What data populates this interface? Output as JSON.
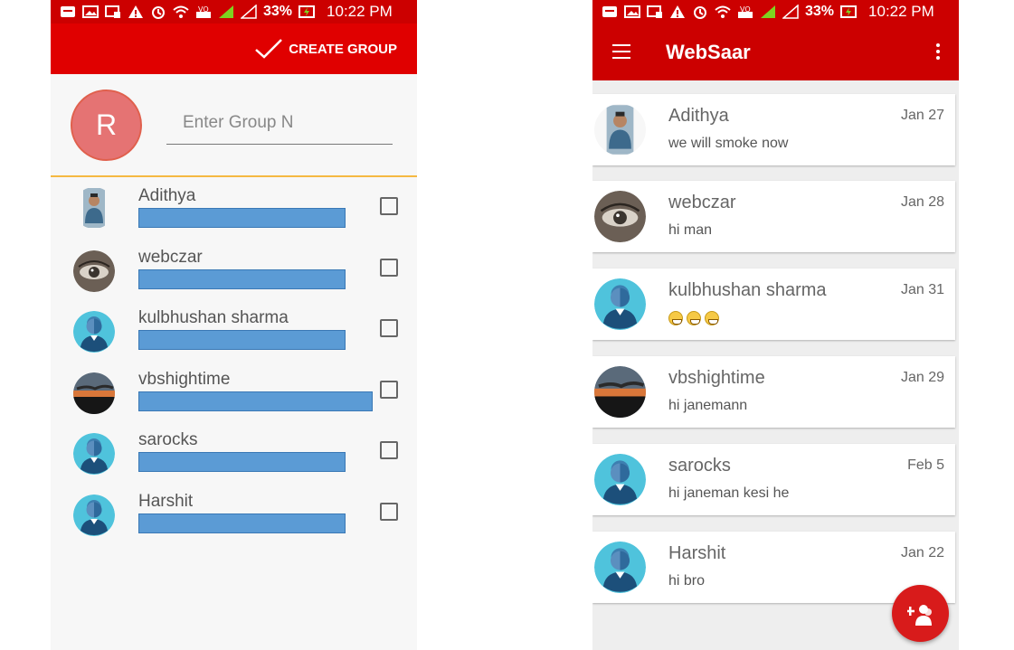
{
  "status_bar": {
    "battery": "33%",
    "time": "10:22 PM"
  },
  "left": {
    "create_group_label": "CREATE GROUP",
    "group_avatar_letter": "R",
    "group_name_value": "Enter Group N",
    "members": [
      {
        "name": "Adithya",
        "avatar": "photo-person"
      },
      {
        "name": "webczar",
        "avatar": "photo-eye"
      },
      {
        "name": "kulbhushan sharma",
        "avatar": "default-user"
      },
      {
        "name": "vbshightime",
        "avatar": "photo-sunset"
      },
      {
        "name": "sarocks",
        "avatar": "default-user"
      },
      {
        "name": "Harshit",
        "avatar": "default-user"
      }
    ]
  },
  "right": {
    "app_title": "WebSaar",
    "chats": [
      {
        "name": "Adithya",
        "date": "Jan 27",
        "message": "we will smoke now",
        "avatar": "photo-person"
      },
      {
        "name": "webczar",
        "date": "Jan 28",
        "message": "hi man",
        "avatar": "photo-eye"
      },
      {
        "name": "kulbhushan sharma",
        "date": "Jan 31",
        "message": "",
        "emoji_count": 3,
        "avatar": "default-user"
      },
      {
        "name": "vbshightime",
        "date": "Jan 29",
        "message": "hi janemann",
        "avatar": "photo-sunset"
      },
      {
        "name": "sarocks",
        "date": "Feb 5",
        "message": "hi janeman kesi he",
        "avatar": "default-user"
      },
      {
        "name": "Harshit",
        "date": "Jan 22",
        "message": "hi bro",
        "avatar": "default-user"
      }
    ]
  },
  "colors": {
    "primary": "#cc0000",
    "accent_line": "#f5b942",
    "fab": "#d81b1b",
    "avatar_R": "#e57373"
  }
}
